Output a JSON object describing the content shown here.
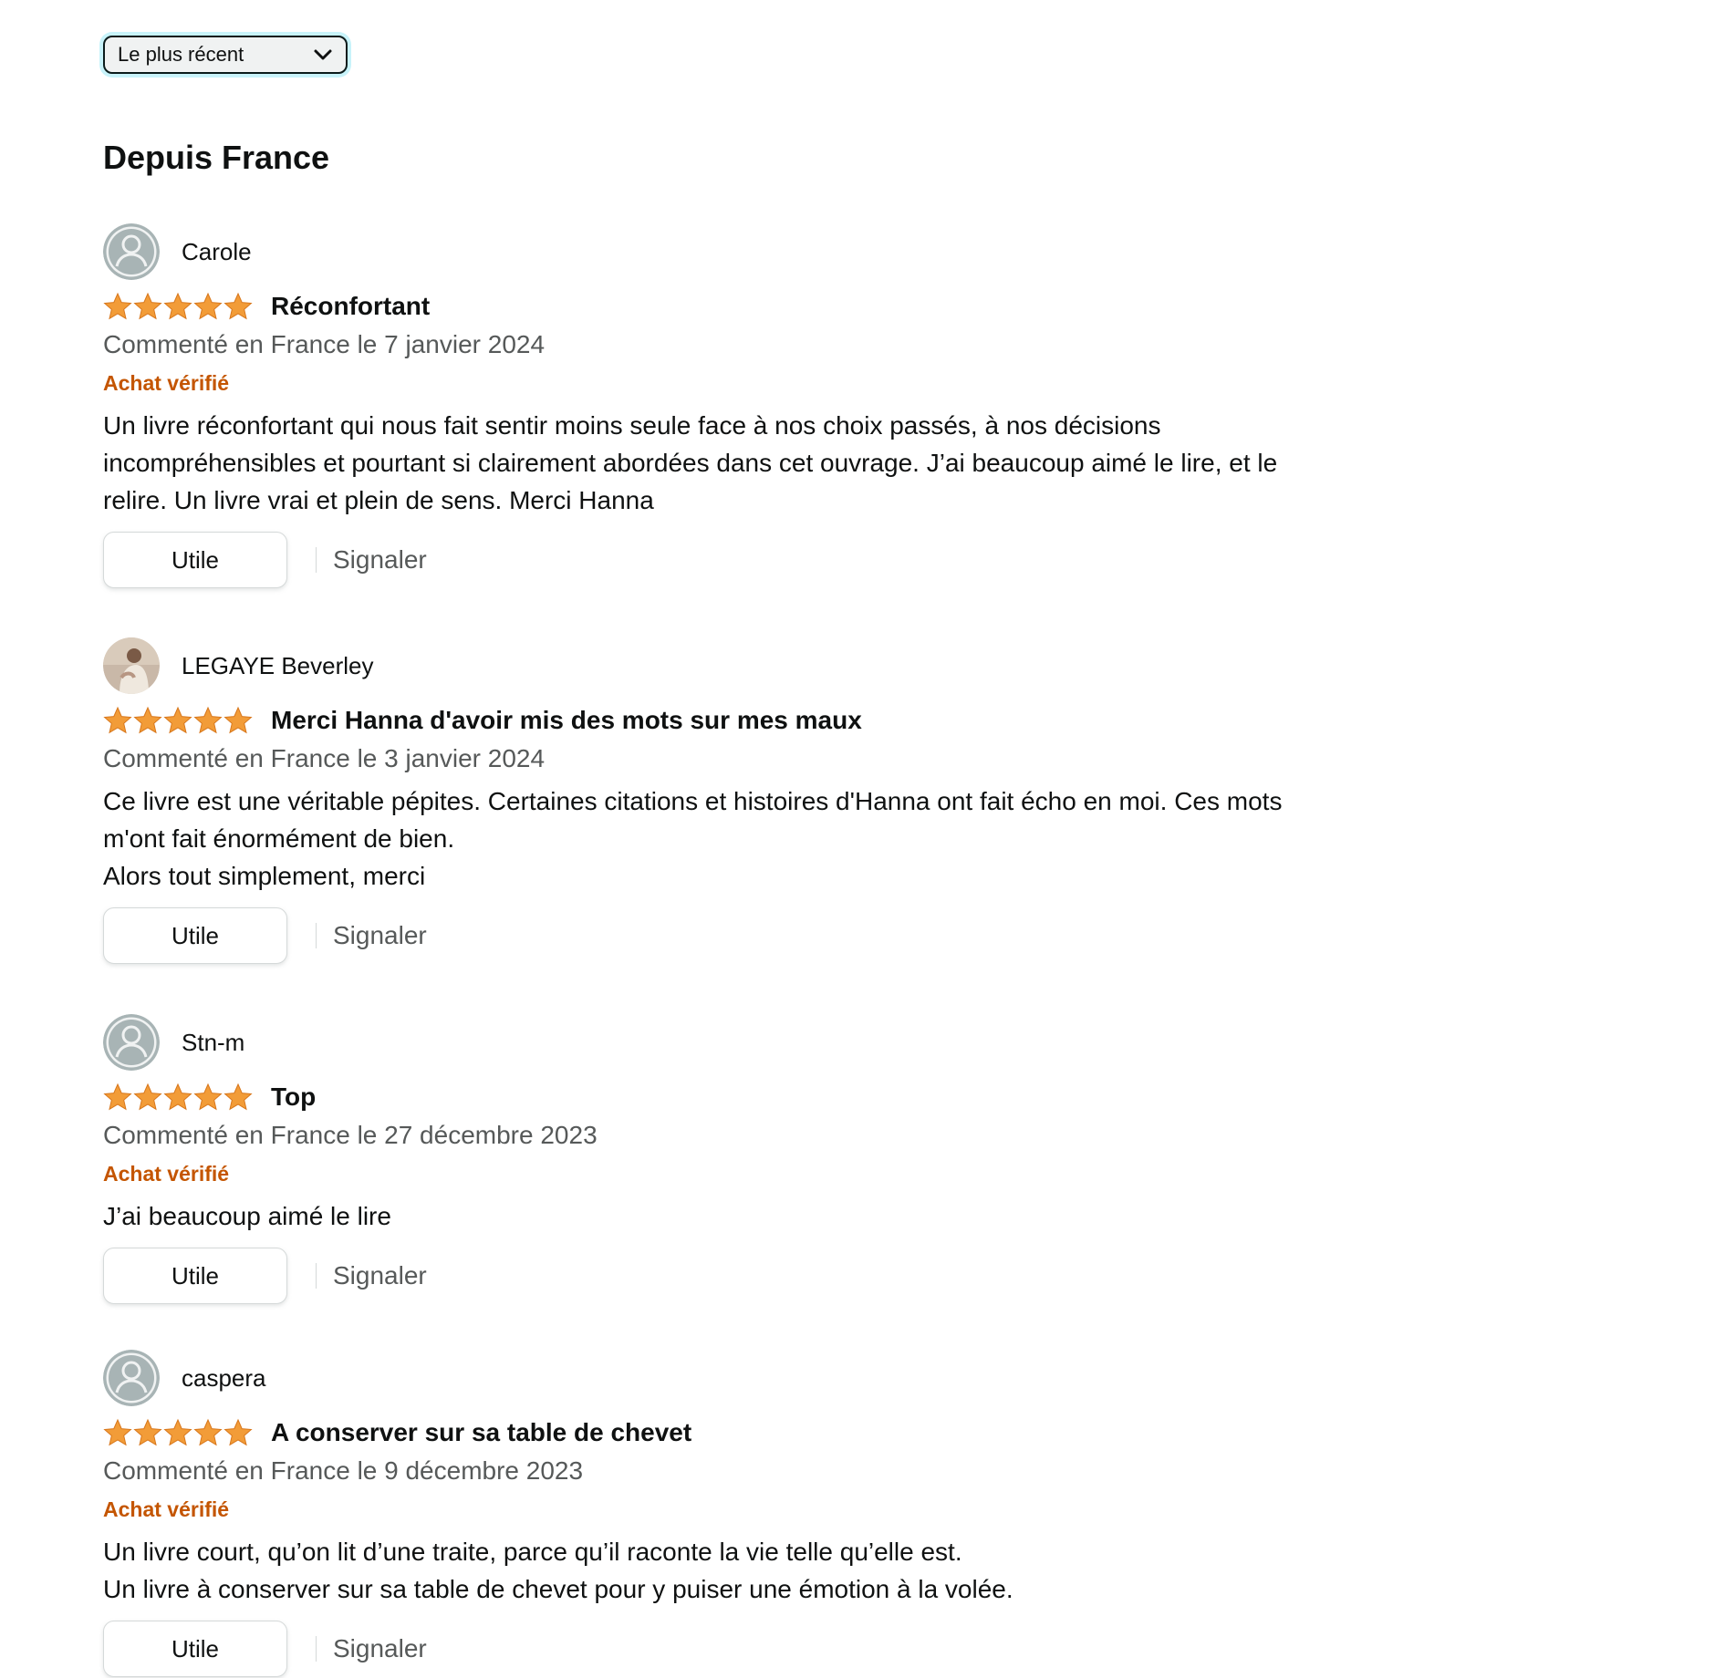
{
  "sort": {
    "selected": "Le plus récent",
    "icon": "chevron-down-icon"
  },
  "section_title": "Depuis France",
  "colors": {
    "star": "#f29c38",
    "verified": "#c45500",
    "muted": "#565959",
    "text": "#0f1111"
  },
  "reviews": [
    {
      "author": "Carole",
      "avatar": "default-avatar",
      "rating": 5,
      "title": "Réconfortant",
      "date": "Commenté en France le 7 janvier 2024",
      "verified": "Achat vérifié",
      "body": "Un livre réconfortant qui nous fait sentir moins seule face à nos choix passés, à nos décisions\nincompréhensibles et pourtant si clairement abordées dans cet ouvrage. J’ai beaucoup aimé le lire, et le\nrelire. Un livre vrai et plein de sens. Merci Hanna",
      "helpful_label": "Utile",
      "report_label": "Signaler"
    },
    {
      "author": "LEGAYE Beverley",
      "avatar": "photo-avatar",
      "rating": 5,
      "title": "Merci Hanna d'avoir mis des mots sur mes maux",
      "date": "Commenté en France le 3 janvier 2024",
      "verified": "",
      "body": "Ce livre est une véritable pépites. Certaines citations et histoires d'Hanna ont fait écho en moi. Ces mots\nm'ont fait énormément de bien.\nAlors tout simplement, merci",
      "helpful_label": "Utile",
      "report_label": "Signaler"
    },
    {
      "author": "Stn-m",
      "avatar": "default-avatar",
      "rating": 5,
      "title": "Top",
      "date": "Commenté en France le 27 décembre 2023",
      "verified": "Achat vérifié",
      "body": "J’ai beaucoup aimé le lire",
      "helpful_label": "Utile",
      "report_label": "Signaler"
    },
    {
      "author": "caspera",
      "avatar": "default-avatar",
      "rating": 5,
      "title": "A conserver sur sa table de chevet",
      "date": "Commenté en France le 9 décembre 2023",
      "verified": "Achat vérifié",
      "body": "Un livre court, qu’on lit d’une traite, parce qu’il raconte la vie telle qu’elle est.\nUn livre à conserver sur sa table de chevet pour y puiser une émotion à la volée.",
      "helpful_label": "Utile",
      "report_label": "Signaler"
    }
  ]
}
